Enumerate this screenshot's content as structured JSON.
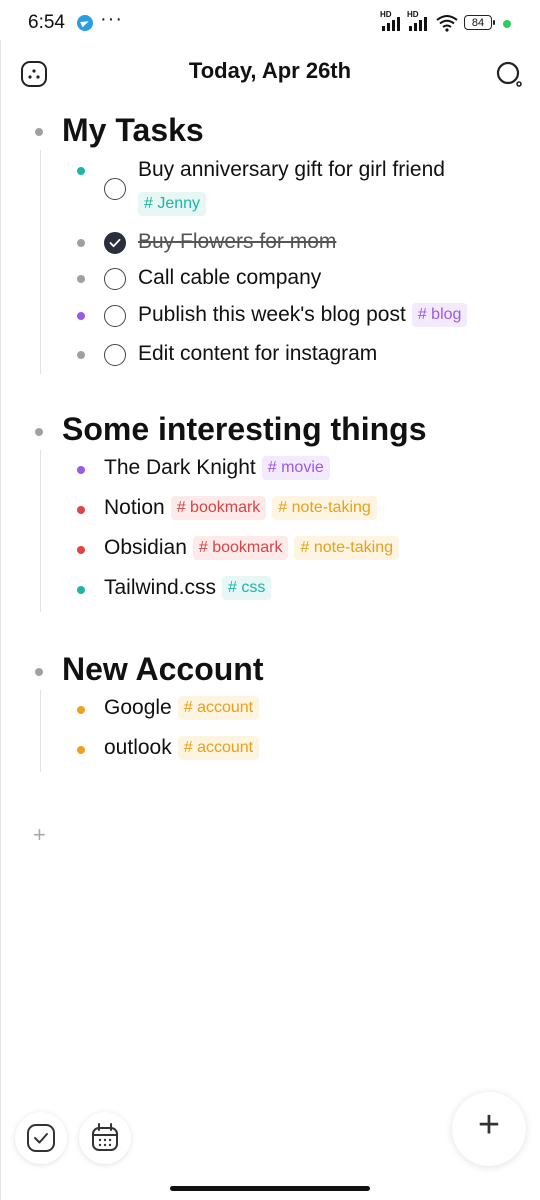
{
  "status_bar": {
    "time": "6:54",
    "more": "···",
    "hd1": "HD",
    "hd2": "HD",
    "battery": "84"
  },
  "header": {
    "title": "Today, Apr 26th"
  },
  "sections": [
    {
      "title": "My Tasks",
      "items": [
        {
          "text": "Buy anniversary gift for girl friend",
          "checked": false,
          "dot": "#1db5a6",
          "tags": [
            {
              "label": "# Jenny",
              "color": "#1db5a6",
              "bg": "#e6f7f5"
            }
          ]
        },
        {
          "text": "Buy Flowers for mom",
          "checked": true,
          "dot": "#a0a0a0",
          "tags": []
        },
        {
          "text": "Call cable company",
          "checked": false,
          "dot": "#a0a0a0",
          "tags": []
        },
        {
          "text": "Publish this week's blog post",
          "checked": false,
          "dot": "#9b59e6",
          "tags": [
            {
              "label": "# blog",
              "color": "#9b59e6",
              "bg": "#f3ebfd"
            }
          ]
        },
        {
          "text": "Edit content for instagram",
          "checked": false,
          "dot": "#a0a0a0",
          "tags": []
        }
      ]
    },
    {
      "title": "Some interesting things",
      "items": [
        {
          "text": "The Dark Knight",
          "dot": "#9b59e6",
          "tags": [
            {
              "label": "# movie",
              "color": "#9b59e6",
              "bg": "#f3ebfd"
            }
          ]
        },
        {
          "text": "Notion",
          "dot": "#e04545",
          "tags": [
            {
              "label": "# bookmark",
              "color": "#d64545",
              "bg": "#fdeaea"
            },
            {
              "label": "# note-taking",
              "color": "#e6a21a",
              "bg": "#fdf4e1"
            }
          ]
        },
        {
          "text": "Obsidian",
          "dot": "#e04545",
          "tags": [
            {
              "label": "# bookmark",
              "color": "#d64545",
              "bg": "#fdeaea"
            },
            {
              "label": "# note-taking",
              "color": "#e6a21a",
              "bg": "#fdf4e1"
            }
          ]
        },
        {
          "text": "Tailwind.css",
          "dot": "#1db5a6",
          "tags": [
            {
              "label": "# css",
              "color": "#1db5a6",
              "bg": "#e6f7f5"
            }
          ]
        }
      ]
    },
    {
      "title": "New Account",
      "items": [
        {
          "text": "Google",
          "dot": "#f0a020",
          "tags": [
            {
              "label": "# account",
              "color": "#e6a21a",
              "bg": "#fdf4e1"
            }
          ]
        },
        {
          "text": "outlook",
          "dot": "#f0a020",
          "tags": [
            {
              "label": "# account",
              "color": "#e6a21a",
              "bg": "#fdf4e1"
            }
          ]
        }
      ]
    }
  ],
  "add_block": "+",
  "fab": "+",
  "colors": {
    "section_bullet": "#a0a0a0",
    "accent_dark": "#2b2f3a"
  }
}
